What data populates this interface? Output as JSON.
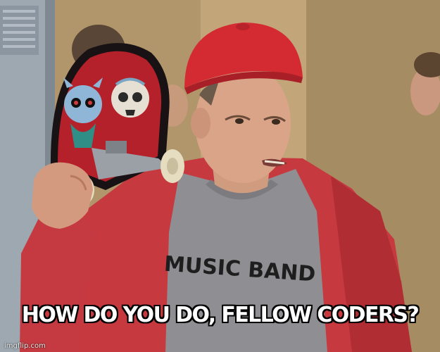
{
  "meme": {
    "caption": "HOW DO YOU DO, FELLOW CODERS?",
    "shirt_text": "MUSIC BAND",
    "watermark": "imgflip.com"
  },
  "colors": {
    "hat": "#d42b33",
    "hoodie": "#c93a3f",
    "shirt": "#8f8f93",
    "skin": "#d9a488",
    "lockers": "#9aa4ae",
    "background": "#b49a6e"
  }
}
